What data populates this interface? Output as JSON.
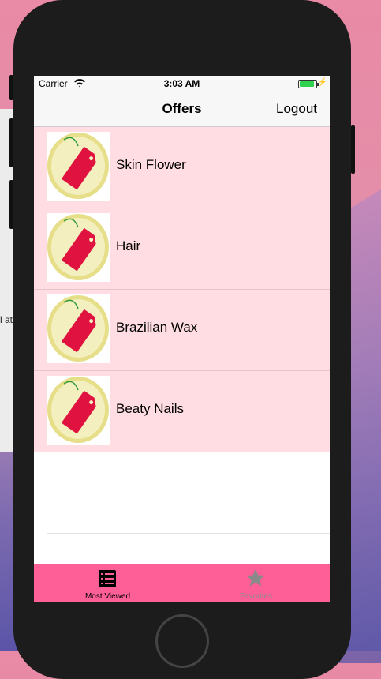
{
  "background_window": {
    "partial_text": "l at"
  },
  "status_bar": {
    "carrier": "Carrier",
    "time": "3:03 AM",
    "battery_percent": 100
  },
  "nav": {
    "title": "Offers",
    "logout_label": "Logout"
  },
  "offers": [
    {
      "label": "Skin Flower",
      "icon": "price-tag-icon"
    },
    {
      "label": "Hair",
      "icon": "price-tag-icon"
    },
    {
      "label": "Brazilian Wax",
      "icon": "price-tag-icon"
    },
    {
      "label": "Beaty Nails",
      "icon": "price-tag-icon"
    }
  ],
  "tabs": [
    {
      "label": "Most Viewed",
      "icon": "list-icon",
      "selected": true
    },
    {
      "label": "Favorites",
      "icon": "star-icon",
      "selected": false
    }
  ],
  "colors": {
    "row_background": "#ffdde3",
    "tab_bar": "#fe5f97",
    "battery": "#2fd24f"
  }
}
